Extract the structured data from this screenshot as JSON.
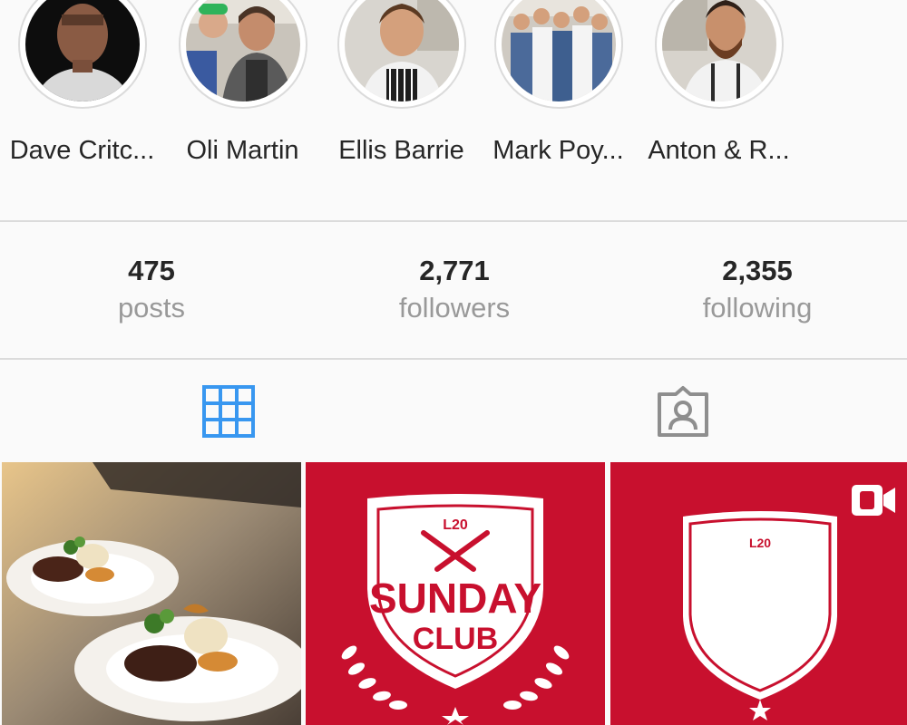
{
  "highlights": [
    {
      "label": "Dave Critc..."
    },
    {
      "label": "Oli Martin"
    },
    {
      "label": "Ellis Barrie"
    },
    {
      "label": "Mark Poy..."
    },
    {
      "label": "Anton & R..."
    }
  ],
  "stats": {
    "posts": {
      "value": "475",
      "label": "posts"
    },
    "followers": {
      "value": "2,771",
      "label": "followers"
    },
    "following": {
      "value": "2,355",
      "label": "following"
    }
  },
  "tabs": [
    {
      "icon": "grid-icon",
      "active": true
    },
    {
      "icon": "tagged-person-icon",
      "active": false
    }
  ],
  "posts": [
    {
      "type": "photo"
    },
    {
      "type": "photo",
      "badge_small": "L20",
      "badge_title_1": "SUNDAY",
      "badge_title_2": "CLUB"
    },
    {
      "type": "video",
      "badge_small": "L20"
    }
  ],
  "colors": {
    "accent": "#3897f0",
    "brand_red": "#c8102e",
    "muted": "#999999",
    "border": "#dbdbdb"
  }
}
